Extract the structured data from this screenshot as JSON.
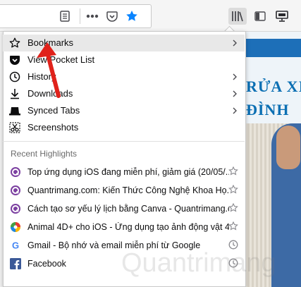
{
  "toolbar": {
    "icons": [
      "reader-view-icon",
      "page-actions-icon",
      "pocket-icon",
      "bookmark-star-icon",
      "library-icon",
      "sidebars-icon",
      "synced-screen-icon"
    ]
  },
  "menu": {
    "items": [
      {
        "label": "Bookmarks",
        "icon": "star-icon",
        "submenu": true
      },
      {
        "label": "View Pocket List",
        "icon": "pocket-icon",
        "submenu": false
      },
      {
        "label": "History",
        "icon": "clock-icon",
        "submenu": true
      },
      {
        "label": "Downloads",
        "icon": "download-icon",
        "submenu": true
      },
      {
        "label": "Synced Tabs",
        "icon": "synced-tabs-icon",
        "submenu": true
      },
      {
        "label": "Screenshots",
        "icon": "scissors-icon",
        "submenu": false
      }
    ],
    "recent_title": "Recent Highlights",
    "highlights": [
      {
        "label": "Top ứng dụng iOS đang miễn phí, giảm giá (20/05/...",
        "icon": "site-q-icon",
        "action": "star-icon"
      },
      {
        "label": "Quantrimang.com: Kiến Thức Công Nghệ Khoa Họ...",
        "icon": "site-q-icon",
        "action": "star-icon"
      },
      {
        "label": "Cách tạo sơ yếu lý lịch bằng Canva - Quantrimang.c...",
        "icon": "site-q-icon",
        "action": "star-icon"
      },
      {
        "label": "Animal 4D+ cho iOS - Ứng dụng tạo ảnh động vật 4...",
        "icon": "colorful-site-icon",
        "action": "star-icon"
      },
      {
        "label": "Gmail - Bộ nhớ và email miễn phí từ Google",
        "icon": "google-icon",
        "action": "clock-icon"
      },
      {
        "label": "Facebook",
        "icon": "facebook-icon",
        "action": "clock-icon"
      }
    ]
  },
  "page": {
    "text_line1": "RỬA XI",
    "text_line2": "ĐÌNH"
  },
  "watermark": "Quantrimang",
  "colors": {
    "accent": "#0a84ff",
    "arrow": "#e0221b",
    "pocket": "#ef4056",
    "facebook": "#3b5998",
    "q_purple": "#7b3fa0"
  }
}
